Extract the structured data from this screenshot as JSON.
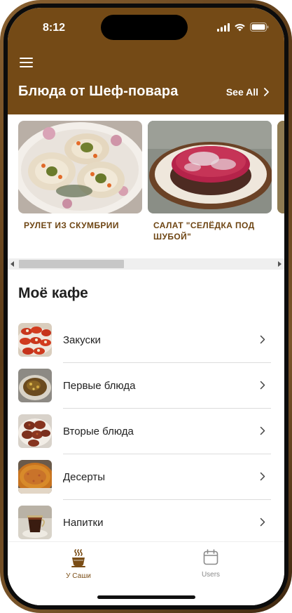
{
  "status_bar": {
    "time": "8:12"
  },
  "header": {
    "title": "Блюда от Шеф-повара",
    "see_all": "See All"
  },
  "chef_dishes": [
    {
      "label": "РУЛЕТ ИЗ СКУМБРИИ"
    },
    {
      "label": "САЛАТ \"СЕЛЁДКА ПОД ШУБОЙ\""
    }
  ],
  "cafe": {
    "title": "Моё кафе",
    "categories": [
      {
        "label": "Закуски"
      },
      {
        "label": "Первые блюда"
      },
      {
        "label": "Вторые блюда"
      },
      {
        "label": "Десерты"
      },
      {
        "label": "Напитки"
      }
    ]
  },
  "tabs": [
    {
      "label": "У Саши",
      "icon": "coffee-cup-icon",
      "active": true
    },
    {
      "label": "Users",
      "icon": "calendar-icon",
      "active": false
    }
  ],
  "colors": {
    "brand": "#744a16",
    "active_tab": "#7a4d16",
    "inactive_tab": "#8a8a8a"
  }
}
